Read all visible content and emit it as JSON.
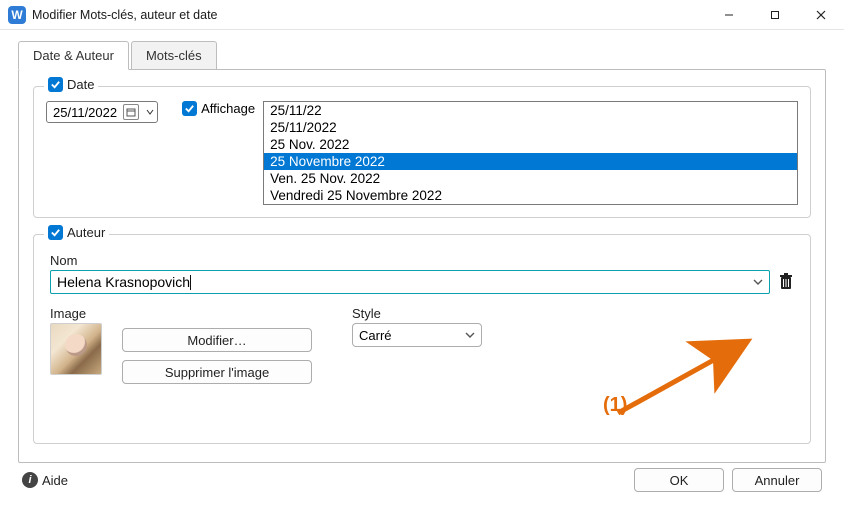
{
  "window": {
    "title": "Modifier Mots-clés, auteur et date"
  },
  "tabs": {
    "date_auteur": "Date & Auteur",
    "mots_cles": "Mots-clés",
    "active": "date_auteur"
  },
  "date": {
    "legend": "Date",
    "value": "25/11/2022",
    "affichage_label": "Affichage",
    "formats": [
      "25/11/22",
      "25/11/2022",
      "25 Nov. 2022",
      "25 Novembre 2022",
      "Ven. 25 Nov. 2022",
      "Vendredi 25 Novembre 2022"
    ],
    "selected_index": 3
  },
  "auteur": {
    "legend": "Auteur",
    "nom_label": "Nom",
    "nom_value": "Helena Krasnopovich",
    "image_label": "Image",
    "modifier_btn": "Modifier…",
    "supprimer_btn": "Supprimer l'image",
    "style_label": "Style",
    "style_value": "Carré"
  },
  "annotation": {
    "label": "(1)"
  },
  "footer": {
    "help": "Aide",
    "ok": "OK",
    "cancel": "Annuler"
  },
  "icons": {
    "app_letter": "W",
    "help_glyph": "i"
  }
}
